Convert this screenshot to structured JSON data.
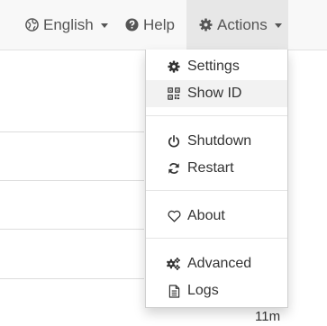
{
  "nav": {
    "language": {
      "label": "English",
      "icon": "globe-icon"
    },
    "help": {
      "label": "Help",
      "icon": "question-circle-icon"
    },
    "actions": {
      "label": "Actions",
      "icon": "gear-icon"
    }
  },
  "dropdown": {
    "settings": {
      "label": "Settings",
      "icon": "gear-icon"
    },
    "show_id": {
      "label": "Show ID",
      "icon": "qrcode-icon"
    },
    "shutdown": {
      "label": "Shutdown",
      "icon": "power-icon"
    },
    "restart": {
      "label": "Restart",
      "icon": "refresh-icon"
    },
    "about": {
      "label": "About",
      "icon": "heart-icon"
    },
    "advanced": {
      "label": "Advanced",
      "icon": "cogs-icon"
    },
    "logs": {
      "label": "Logs",
      "icon": "file-text-icon"
    }
  },
  "background": {
    "time_text": "11m"
  },
  "colors": {
    "navbar": "#f8f8f8",
    "active_nav": "#e7e7e7",
    "hover_item": "#f2f2f2",
    "text": "#333333"
  }
}
